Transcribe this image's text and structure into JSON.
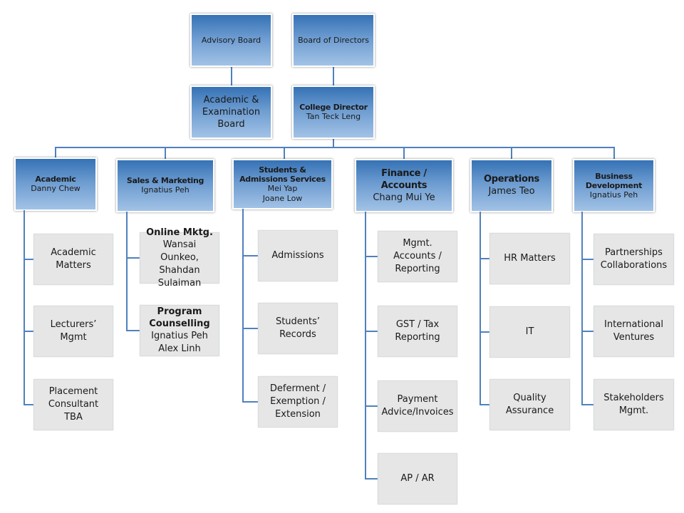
{
  "top": [
    {
      "label": "Advisory Board"
    },
    {
      "label": "Board of Directors"
    }
  ],
  "second": [
    {
      "label": "Academic & Examination Board"
    },
    {
      "title": "College Director",
      "name": "Tan Teck Leng"
    }
  ],
  "departments": [
    {
      "title": "Academic",
      "names": [
        "Danny Chew"
      ],
      "units": [
        {
          "label": "Academic Matters"
        },
        {
          "label": "Lecturers’ Mgmt"
        },
        {
          "label": "Placement Consultant TBA"
        }
      ]
    },
    {
      "title": "Sales & Marketing",
      "names": [
        "Ignatius Peh"
      ],
      "units": [
        {
          "title": "Online Mktg.",
          "label": "Wansai Ounkeo, Shahdan Sulaiman"
        },
        {
          "title": "Program Counselling",
          "label": "Ignatius Peh Alex Linh"
        }
      ]
    },
    {
      "title": "Students & Admissions Services",
      "names": [
        "Mei Yap",
        "Joane Low"
      ],
      "units": [
        {
          "label": "Admissions"
        },
        {
          "label": "Students’ Records"
        },
        {
          "label": "Deferment / Exemption / Extension"
        }
      ]
    },
    {
      "title": "Finance / Accounts",
      "names": [
        "Chang Mui Ye"
      ],
      "units": [
        {
          "label": "Mgmt. Accounts / Reporting"
        },
        {
          "label": "GST / Tax Reporting"
        },
        {
          "label": "Payment Advice/Invoices"
        },
        {
          "label": "AP / AR"
        }
      ]
    },
    {
      "title": "Operations",
      "names": [
        "James Teo"
      ],
      "units": [
        {
          "label": "HR Matters"
        },
        {
          "label": "IT"
        },
        {
          "label": "Quality Assurance"
        }
      ]
    },
    {
      "title": "Business Development",
      "names": [
        "Ignatius Peh"
      ],
      "units": [
        {
          "label": "Partnerships Collaborations"
        },
        {
          "label": "International Ventures"
        },
        {
          "label": "Stakeholders Mgmt."
        }
      ]
    }
  ],
  "colors": {
    "box_gradient_top": "#3572b5",
    "box_gradient_bottom": "#a2c2e6",
    "connector": "#4f81bd",
    "unit_box": "#e6e6e6"
  }
}
